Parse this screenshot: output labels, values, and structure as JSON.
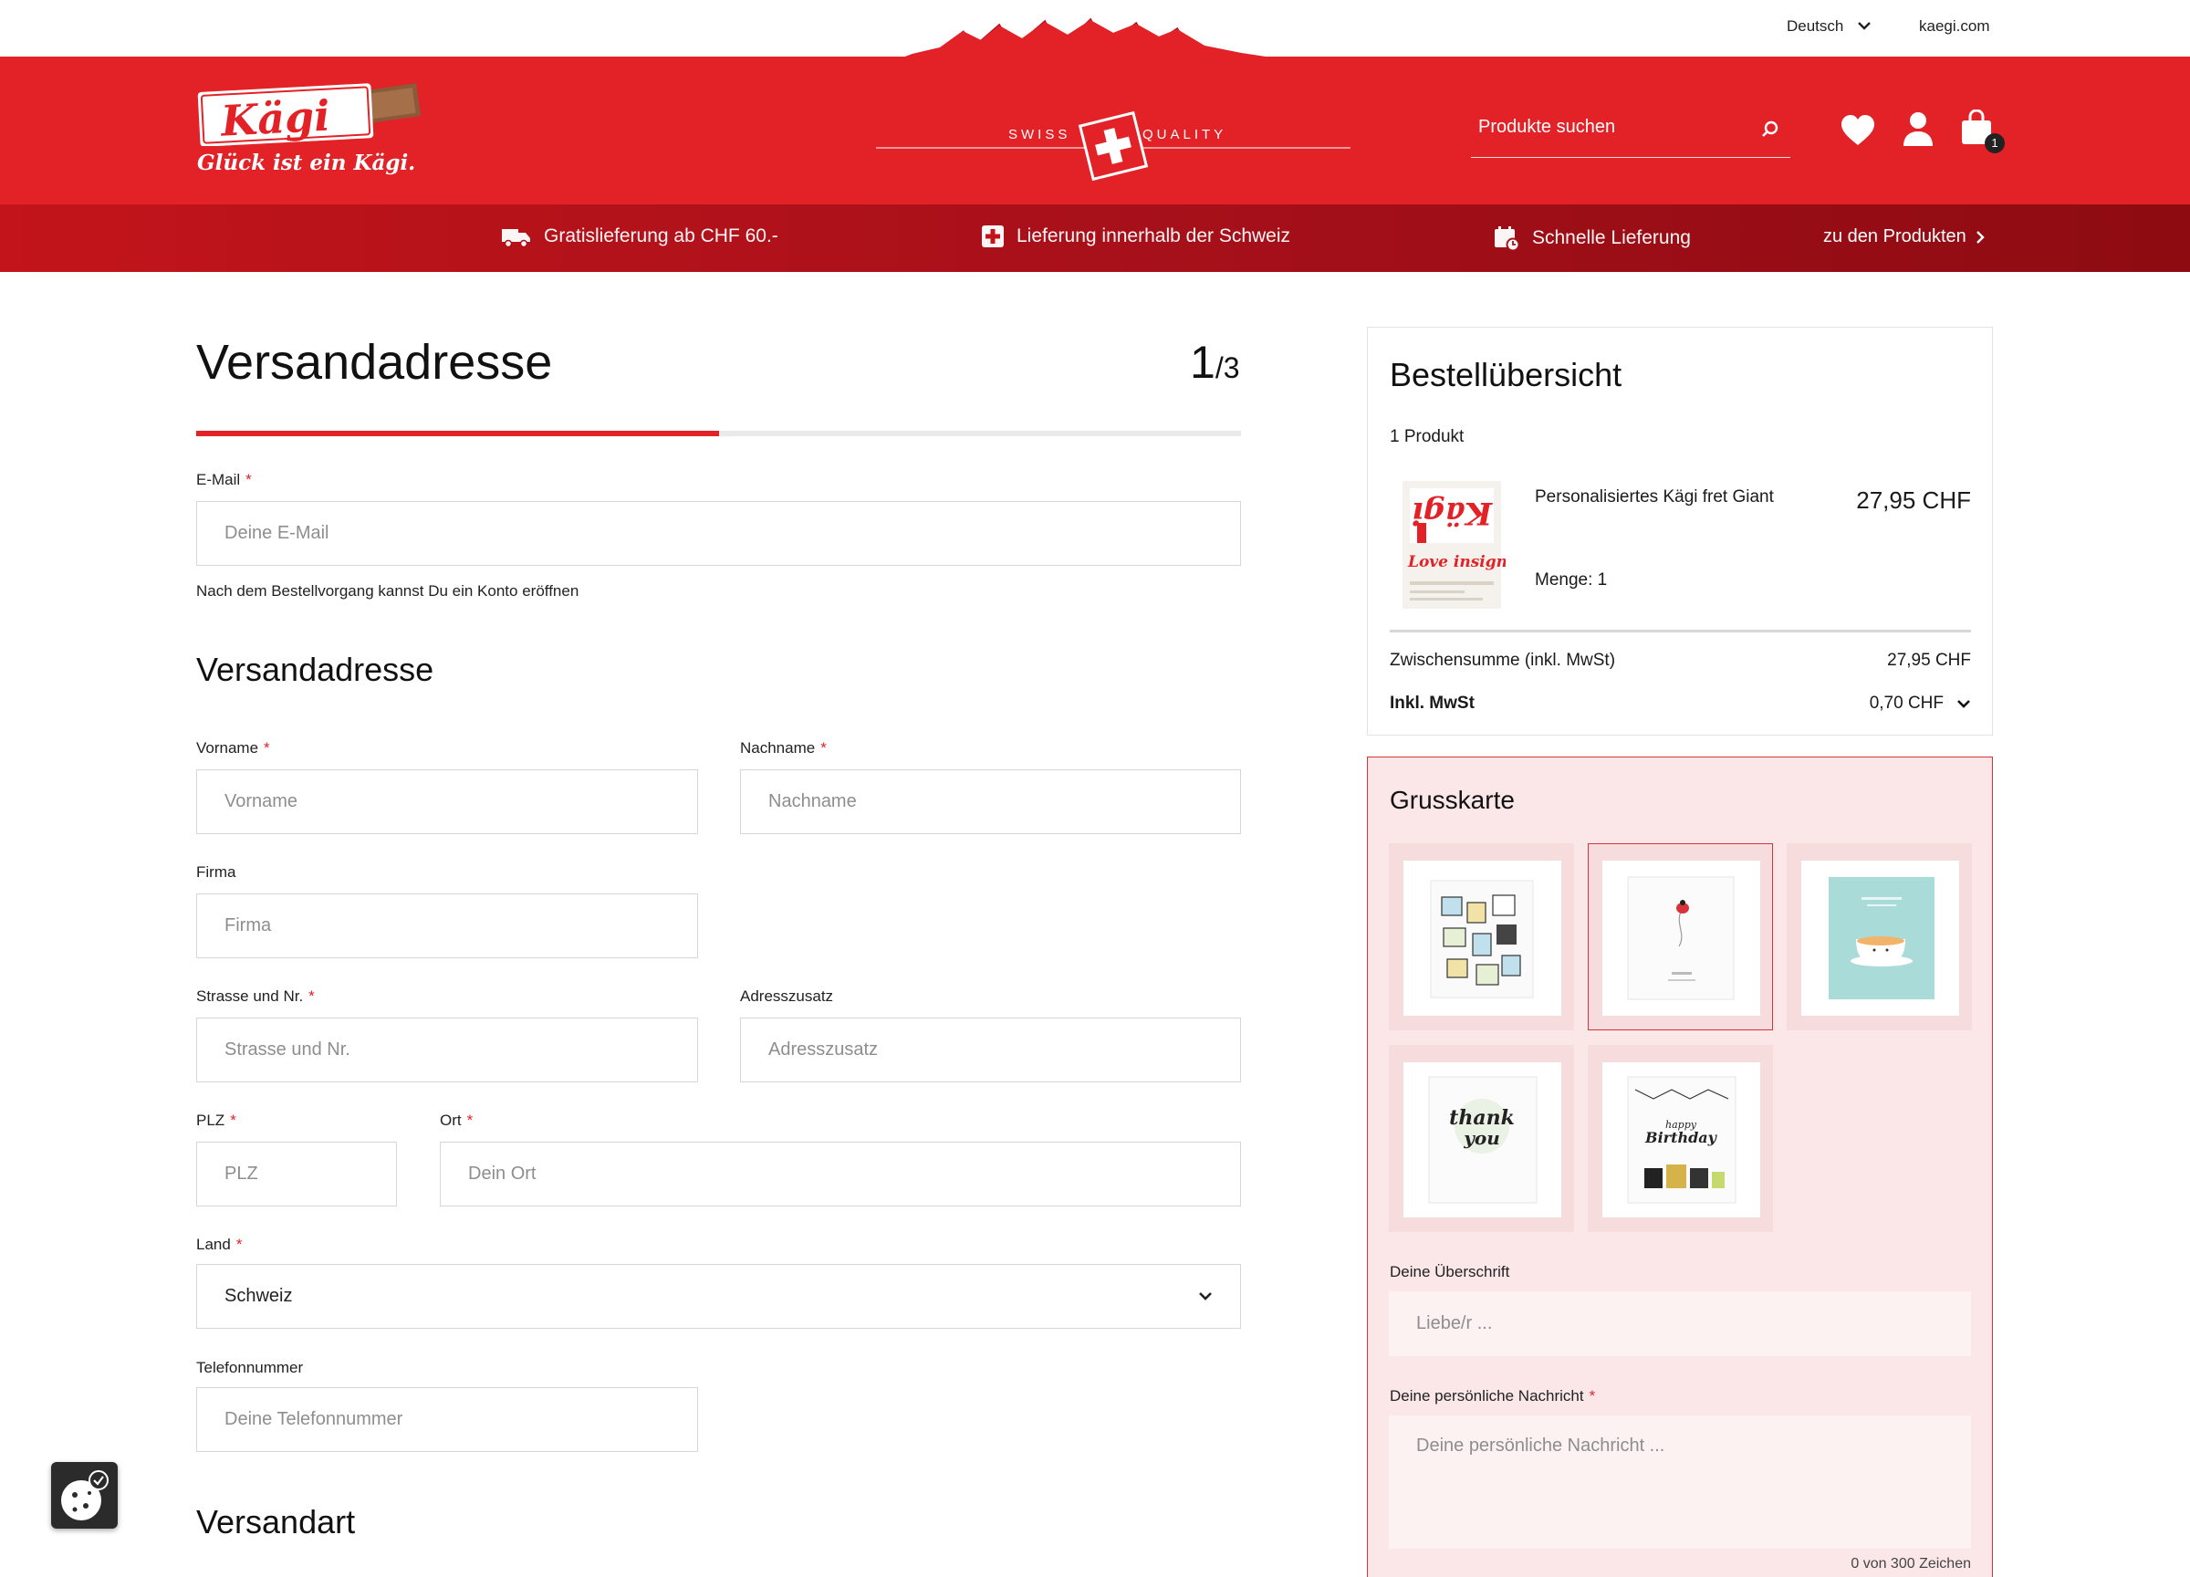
{
  "topbar": {
    "language": "Deutsch",
    "site_link": "kaegi.com"
  },
  "header": {
    "logo_text": "Kägi",
    "tagline": "Glück ist ein Kägi.",
    "badge_left": "SWISS",
    "badge_right": "QUALITY",
    "search_placeholder": "Produkte suchen",
    "cart_count": "1"
  },
  "usp": [
    {
      "label": "Gratislieferung ab CHF 60.-",
      "icon": "truck-icon"
    },
    {
      "label": "Lieferung innerhalb der Schweiz",
      "icon": "swiss-cross-icon"
    },
    {
      "label": "Schnelle Lieferung",
      "icon": "calendar-clock-icon"
    }
  ],
  "usp_link": "zu den Produkten",
  "form": {
    "title": "Versandadresse",
    "step_current": "1",
    "step_total": "/3",
    "progress": 0.5,
    "email": {
      "label": "E-Mail",
      "placeholder": "Deine E-Mail"
    },
    "hint": "Nach dem Bestellvorgang kannst Du ein Konto eröffnen",
    "section_address": "Versandadresse",
    "firstname": {
      "label": "Vorname",
      "placeholder": "Vorname"
    },
    "lastname": {
      "label": "Nachname",
      "placeholder": "Nachname"
    },
    "company": {
      "label": "Firma",
      "placeholder": "Firma"
    },
    "street": {
      "label": "Strasse und Nr.",
      "placeholder": "Strasse und Nr."
    },
    "addition": {
      "label": "Adresszusatz",
      "placeholder": "Adresszusatz"
    },
    "zip": {
      "label": "PLZ",
      "placeholder": "PLZ"
    },
    "city": {
      "label": "Ort",
      "placeholder": "Dein Ort"
    },
    "country": {
      "label": "Land",
      "value": "Schweiz"
    },
    "phone": {
      "label": "Telefonnummer",
      "placeholder": "Deine Telefonnummer"
    },
    "section_shipping": "Versandart",
    "required_mark": "*"
  },
  "summary": {
    "title": "Bestellübersicht",
    "product_count": "1 Produkt",
    "product_name": "Personalisiertes Kägi fret Giant",
    "product_price": "27,95 CHF",
    "product_qty": "Menge: 1",
    "product_image_text_1": "Love insign",
    "subtotal_label": "Zwischensumme (inkl. MwSt)",
    "subtotal_value": "27,95 CHF",
    "tax_label": "Inkl. MwSt",
    "tax_value": "0,70 CHF"
  },
  "greeting": {
    "title": "Grusskarte",
    "cards": [
      {
        "name": "gifts",
        "selected": false
      },
      {
        "name": "ladybug",
        "selected": true
      },
      {
        "name": "coffee",
        "selected": false
      },
      {
        "name": "thank-you",
        "selected": false
      },
      {
        "name": "happy-birthday",
        "selected": false
      }
    ],
    "card_text_thank": "thank you",
    "card_text_birthday": "Happy Birthday",
    "heading_label": "Deine Überschrift",
    "heading_placeholder": "Liebe/r ...",
    "message_label": "Deine persönliche Nachricht",
    "message_placeholder": "Deine persönliche Nachricht ...",
    "char_count": "0 von 300 Zeichen"
  },
  "colors": {
    "brand_red": "#e32227",
    "dark_red": "#8e0b12",
    "panel_pink": "#fbe7e8"
  }
}
